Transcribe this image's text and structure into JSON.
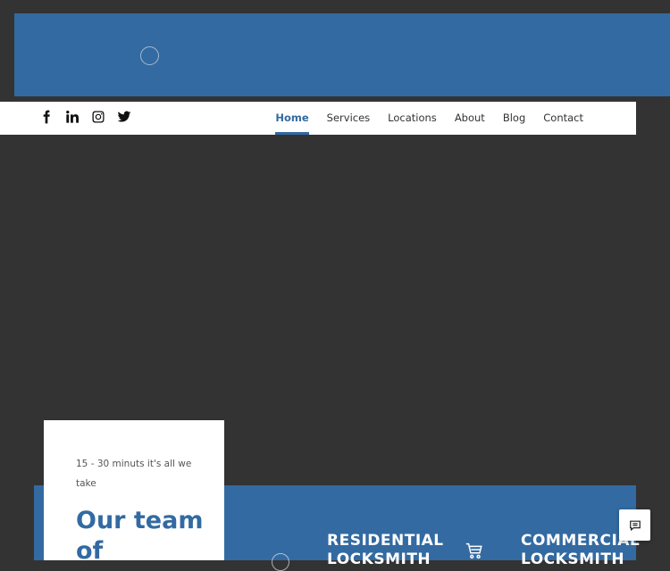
{
  "social": {
    "icons": [
      "facebook-icon",
      "linkedin-icon",
      "instagram-icon",
      "twitter-icon"
    ]
  },
  "nav": {
    "items": [
      {
        "label": "Home",
        "active": true
      },
      {
        "label": "Services",
        "active": false
      },
      {
        "label": "Locations",
        "active": false
      },
      {
        "label": "About",
        "active": false
      },
      {
        "label": "Blog",
        "active": false
      },
      {
        "label": "Contact",
        "active": false
      }
    ]
  },
  "intro": {
    "tagline": "15 - 30 minuts it's all we take",
    "heading": "Our team of"
  },
  "services": {
    "residential": {
      "line1": "RESIDENTIAL",
      "line2": "LOCKSMITH"
    },
    "commercial": {
      "line1": "COMMERCIAL",
      "line2": "LOCKSMITH"
    }
  },
  "colors": {
    "brand": "#336aa1",
    "background": "#333334"
  },
  "icons": {
    "cart": "shopping-cart-icon",
    "chat": "chat-icon"
  }
}
